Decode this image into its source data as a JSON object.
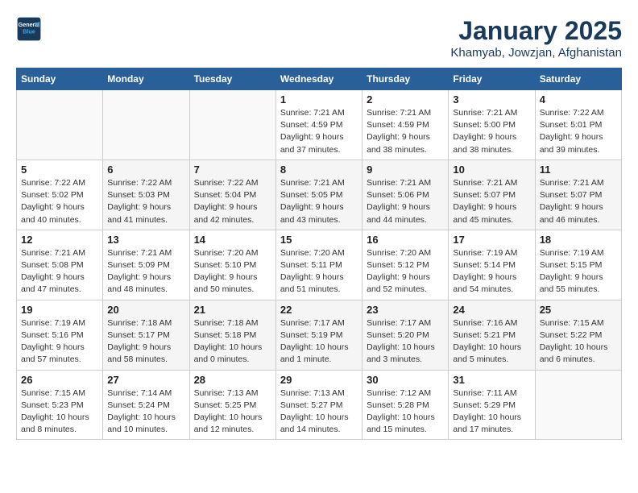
{
  "header": {
    "logo_line1": "General",
    "logo_line2": "Blue",
    "month": "January 2025",
    "location": "Khamyab, Jowzjan, Afghanistan"
  },
  "weekdays": [
    "Sunday",
    "Monday",
    "Tuesday",
    "Wednesday",
    "Thursday",
    "Friday",
    "Saturday"
  ],
  "weeks": [
    [
      {
        "day": "",
        "info": ""
      },
      {
        "day": "",
        "info": ""
      },
      {
        "day": "",
        "info": ""
      },
      {
        "day": "1",
        "info": "Sunrise: 7:21 AM\nSunset: 4:59 PM\nDaylight: 9 hours\nand 37 minutes."
      },
      {
        "day": "2",
        "info": "Sunrise: 7:21 AM\nSunset: 4:59 PM\nDaylight: 9 hours\nand 38 minutes."
      },
      {
        "day": "3",
        "info": "Sunrise: 7:21 AM\nSunset: 5:00 PM\nDaylight: 9 hours\nand 38 minutes."
      },
      {
        "day": "4",
        "info": "Sunrise: 7:22 AM\nSunset: 5:01 PM\nDaylight: 9 hours\nand 39 minutes."
      }
    ],
    [
      {
        "day": "5",
        "info": "Sunrise: 7:22 AM\nSunset: 5:02 PM\nDaylight: 9 hours\nand 40 minutes."
      },
      {
        "day": "6",
        "info": "Sunrise: 7:22 AM\nSunset: 5:03 PM\nDaylight: 9 hours\nand 41 minutes."
      },
      {
        "day": "7",
        "info": "Sunrise: 7:22 AM\nSunset: 5:04 PM\nDaylight: 9 hours\nand 42 minutes."
      },
      {
        "day": "8",
        "info": "Sunrise: 7:21 AM\nSunset: 5:05 PM\nDaylight: 9 hours\nand 43 minutes."
      },
      {
        "day": "9",
        "info": "Sunrise: 7:21 AM\nSunset: 5:06 PM\nDaylight: 9 hours\nand 44 minutes."
      },
      {
        "day": "10",
        "info": "Sunrise: 7:21 AM\nSunset: 5:07 PM\nDaylight: 9 hours\nand 45 minutes."
      },
      {
        "day": "11",
        "info": "Sunrise: 7:21 AM\nSunset: 5:07 PM\nDaylight: 9 hours\nand 46 minutes."
      }
    ],
    [
      {
        "day": "12",
        "info": "Sunrise: 7:21 AM\nSunset: 5:08 PM\nDaylight: 9 hours\nand 47 minutes."
      },
      {
        "day": "13",
        "info": "Sunrise: 7:21 AM\nSunset: 5:09 PM\nDaylight: 9 hours\nand 48 minutes."
      },
      {
        "day": "14",
        "info": "Sunrise: 7:20 AM\nSunset: 5:10 PM\nDaylight: 9 hours\nand 50 minutes."
      },
      {
        "day": "15",
        "info": "Sunrise: 7:20 AM\nSunset: 5:11 PM\nDaylight: 9 hours\nand 51 minutes."
      },
      {
        "day": "16",
        "info": "Sunrise: 7:20 AM\nSunset: 5:12 PM\nDaylight: 9 hours\nand 52 minutes."
      },
      {
        "day": "17",
        "info": "Sunrise: 7:19 AM\nSunset: 5:14 PM\nDaylight: 9 hours\nand 54 minutes."
      },
      {
        "day": "18",
        "info": "Sunrise: 7:19 AM\nSunset: 5:15 PM\nDaylight: 9 hours\nand 55 minutes."
      }
    ],
    [
      {
        "day": "19",
        "info": "Sunrise: 7:19 AM\nSunset: 5:16 PM\nDaylight: 9 hours\nand 57 minutes."
      },
      {
        "day": "20",
        "info": "Sunrise: 7:18 AM\nSunset: 5:17 PM\nDaylight: 9 hours\nand 58 minutes."
      },
      {
        "day": "21",
        "info": "Sunrise: 7:18 AM\nSunset: 5:18 PM\nDaylight: 10 hours\nand 0 minutes."
      },
      {
        "day": "22",
        "info": "Sunrise: 7:17 AM\nSunset: 5:19 PM\nDaylight: 10 hours\nand 1 minute."
      },
      {
        "day": "23",
        "info": "Sunrise: 7:17 AM\nSunset: 5:20 PM\nDaylight: 10 hours\nand 3 minutes."
      },
      {
        "day": "24",
        "info": "Sunrise: 7:16 AM\nSunset: 5:21 PM\nDaylight: 10 hours\nand 5 minutes."
      },
      {
        "day": "25",
        "info": "Sunrise: 7:15 AM\nSunset: 5:22 PM\nDaylight: 10 hours\nand 6 minutes."
      }
    ],
    [
      {
        "day": "26",
        "info": "Sunrise: 7:15 AM\nSunset: 5:23 PM\nDaylight: 10 hours\nand 8 minutes."
      },
      {
        "day": "27",
        "info": "Sunrise: 7:14 AM\nSunset: 5:24 PM\nDaylight: 10 hours\nand 10 minutes."
      },
      {
        "day": "28",
        "info": "Sunrise: 7:13 AM\nSunset: 5:25 PM\nDaylight: 10 hours\nand 12 minutes."
      },
      {
        "day": "29",
        "info": "Sunrise: 7:13 AM\nSunset: 5:27 PM\nDaylight: 10 hours\nand 14 minutes."
      },
      {
        "day": "30",
        "info": "Sunrise: 7:12 AM\nSunset: 5:28 PM\nDaylight: 10 hours\nand 15 minutes."
      },
      {
        "day": "31",
        "info": "Sunrise: 7:11 AM\nSunset: 5:29 PM\nDaylight: 10 hours\nand 17 minutes."
      },
      {
        "day": "",
        "info": ""
      }
    ]
  ]
}
